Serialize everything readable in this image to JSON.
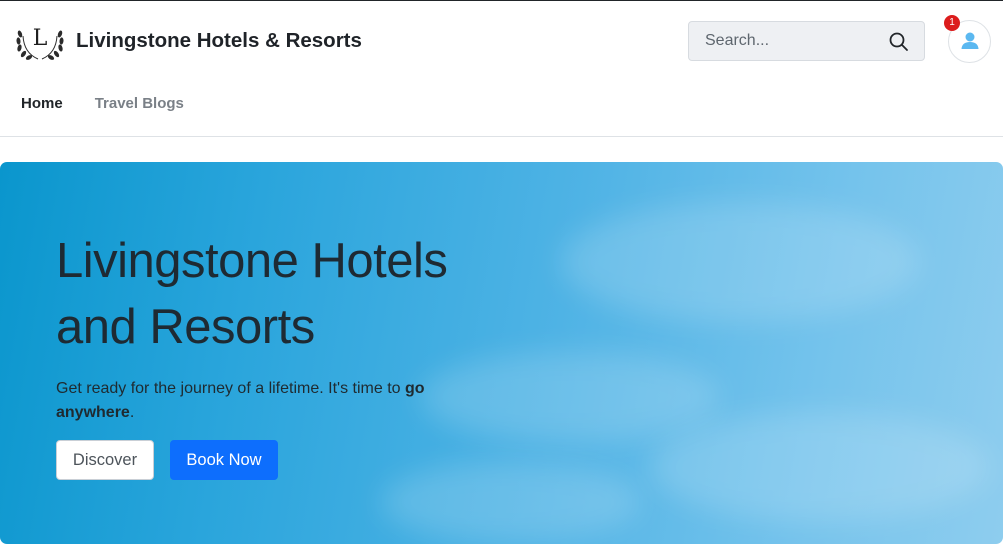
{
  "header": {
    "brand_name": "Livingstone Hotels & Resorts",
    "logo_letter": "L",
    "search": {
      "placeholder": "Search..."
    },
    "notification_count": "1"
  },
  "nav": {
    "items": [
      {
        "label": "Home",
        "active": true
      },
      {
        "label": "Travel Blogs",
        "active": false
      }
    ]
  },
  "hero": {
    "title_line1": "Livingstone Hotels",
    "title_line2": "and Resorts",
    "text_plain": "Get ready for the journey of a lifetime. It's time to ",
    "text_bold": "go anywhere",
    "text_end": ".",
    "discover_label": "Discover",
    "book_label": "Book Now"
  },
  "colors": {
    "primary": "#0d6efd",
    "badge": "#dc1c1c",
    "hero_sky": "#4fb3e5",
    "avatar_icon": "#5bb8f0"
  }
}
